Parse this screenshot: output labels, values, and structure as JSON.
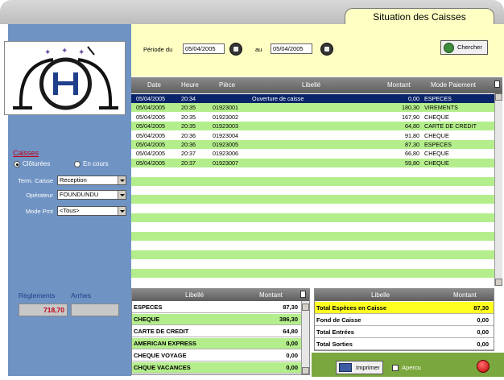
{
  "window": {
    "title": "Situation des Caisses"
  },
  "period": {
    "from_label": "Période du",
    "from_value": "05/04/2005",
    "to_label": "au",
    "to_value": "05/04/2005",
    "search_label": "Chercher"
  },
  "sidebar": {
    "caisses_label": "Caisses",
    "radio_closed": "Clôturées",
    "radio_open": "En cours",
    "term_label": "Term. Caisse",
    "term_value": "Reception",
    "operateur_label": "Opérateur",
    "operateur_value": "FOUNDUNDU",
    "mode_label": "Mode Pmt",
    "mode_value": "<Tous>",
    "reglements_label": "Règlements",
    "arrhes_label": "Arrhes",
    "reglements_value": "718,70",
    "arrhes_value": ""
  },
  "grid": {
    "columns": [
      "Date",
      "Heure",
      "Pièce",
      "Libellé",
      "Montant",
      "Mode Paiement"
    ],
    "rows": [
      {
        "date": "05/04/2005",
        "heure": "20:34",
        "piece": "",
        "libelle": "Ouverture de caisse",
        "montant": "0,00",
        "mode": "ESPECES"
      },
      {
        "date": "05/04/2005",
        "heure": "20:35",
        "piece": "01923001",
        "libelle": "",
        "montant": "180,30",
        "mode": "VIREMENTS"
      },
      {
        "date": "05/04/2005",
        "heure": "20:35",
        "piece": "01923002",
        "libelle": "",
        "montant": "167,90",
        "mode": "CHEQUE"
      },
      {
        "date": "05/04/2005",
        "heure": "20:35",
        "piece": "01923003",
        "libelle": "",
        "montant": "64,80",
        "mode": "CARTE DE CREDIT"
      },
      {
        "date": "05/04/2005",
        "heure": "20:36",
        "piece": "01923004",
        "libelle": "",
        "montant": "91,80",
        "mode": "CHEQUE"
      },
      {
        "date": "05/04/2005",
        "heure": "20:36",
        "piece": "01923005",
        "libelle": "",
        "montant": "87,30",
        "mode": "ESPECES"
      },
      {
        "date": "05/04/2005",
        "heure": "20:37",
        "piece": "01923006",
        "libelle": "",
        "montant": "66,80",
        "mode": "CHEQUE"
      },
      {
        "date": "05/04/2005",
        "heure": "20:37",
        "piece": "01923007",
        "libelle": "",
        "montant": "59,80",
        "mode": "CHEQUE"
      }
    ]
  },
  "summary": {
    "columns": [
      "Libellé",
      "Montant"
    ],
    "rows": [
      {
        "libelle": "ESPECES",
        "montant": "87,30"
      },
      {
        "libelle": "CHEQUE",
        "montant": "386,30"
      },
      {
        "libelle": "CARTE DE CREDIT",
        "montant": "64,80"
      },
      {
        "libelle": "AMERICAN EXPRESS",
        "montant": "0,00"
      },
      {
        "libelle": "CHEQUE VOYAGE",
        "montant": "0,00"
      },
      {
        "libelle": "CHQUE VACANCES",
        "montant": "0,00"
      }
    ]
  },
  "totals": {
    "columns": [
      "Libelle",
      "Montant"
    ],
    "rows": [
      {
        "libelle": "Total Espèces en Caisse",
        "montant": "87,30"
      },
      {
        "libelle": "Fond de Caisse",
        "montant": "0,00"
      },
      {
        "libelle": "Total Entrées",
        "montant": "0,00"
      },
      {
        "libelle": "Total Sorties",
        "montant": "0,00"
      }
    ]
  },
  "actions": {
    "print_label": "Imprimer",
    "preview_label": "Apercu"
  },
  "colors": {
    "sidebar": "#6f93c3",
    "row_green": "#b4ee8c",
    "header_yellow": "#ffffc4",
    "selected_row": "#0a246a",
    "total_highlight": "#ffff20",
    "action_bar": "#7ba83e"
  }
}
